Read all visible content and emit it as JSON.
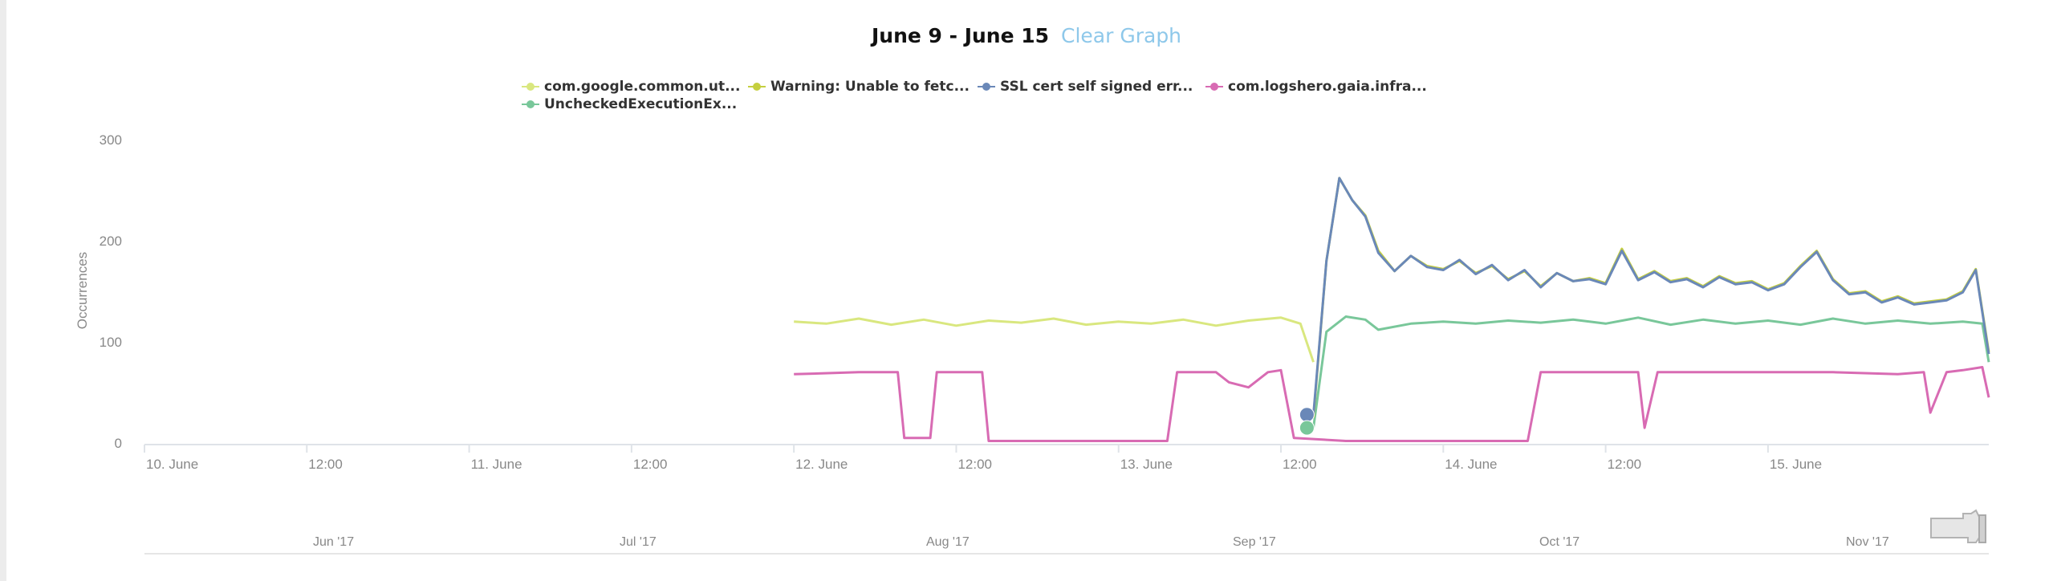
{
  "header": {
    "title": "June 9 - June 15",
    "clear_label": "Clear Graph"
  },
  "colors": {
    "series1": "#d9e77f",
    "series2": "#c5cf3f",
    "series3": "#6a88b8",
    "series4": "#d86bb3",
    "series5": "#79c79a",
    "axis": "#e3e3e3",
    "title_link": "#8ec8ea"
  },
  "chart_data": {
    "type": "line",
    "ylabel": "Occurrences",
    "ylim": [
      0,
      300
    ],
    "yticks": [
      0,
      100,
      200,
      300
    ],
    "x_ticks": [
      "10. June",
      "12:00",
      "11. June",
      "12:00",
      "12. June",
      "12:00",
      "13. June",
      "12:00",
      "14. June",
      "12:00",
      "15. June"
    ],
    "navigator_ticks": [
      "Jun '17",
      "Jul '17",
      "Aug '17",
      "Sep '17",
      "Oct '17",
      "Nov '17"
    ],
    "series": [
      {
        "name": "com.google.common.ut...",
        "color": "#d9e77f",
        "key": "s1",
        "points": [
          [
            12.0,
            120
          ],
          [
            12.1,
            118
          ],
          [
            12.2,
            123
          ],
          [
            12.3,
            117
          ],
          [
            12.4,
            122
          ],
          [
            12.5,
            116
          ],
          [
            12.6,
            121
          ],
          [
            12.7,
            119
          ],
          [
            12.8,
            123
          ],
          [
            12.9,
            117
          ],
          [
            13.0,
            120
          ],
          [
            13.1,
            118
          ],
          [
            13.2,
            122
          ],
          [
            13.3,
            116
          ],
          [
            13.4,
            121
          ],
          [
            13.5,
            124
          ],
          [
            13.56,
            118
          ],
          [
            13.6,
            80
          ]
        ]
      },
      {
        "name": "Warning: Unable to fetc...",
        "color": "#c5cf3f",
        "key": "s2",
        "points": [
          [
            13.6,
            25
          ],
          [
            13.64,
            180
          ],
          [
            13.68,
            262
          ],
          [
            13.72,
            240
          ],
          [
            13.76,
            225
          ],
          [
            13.8,
            190
          ],
          [
            13.85,
            170
          ],
          [
            13.9,
            185
          ],
          [
            13.95,
            175
          ],
          [
            14.0,
            172
          ],
          [
            14.05,
            180
          ],
          [
            14.1,
            168
          ],
          [
            14.15,
            175
          ],
          [
            14.2,
            162
          ],
          [
            14.25,
            170
          ],
          [
            14.3,
            155
          ],
          [
            14.35,
            168
          ],
          [
            14.4,
            160
          ],
          [
            14.45,
            163
          ],
          [
            14.5,
            158
          ],
          [
            14.55,
            192
          ],
          [
            14.6,
            162
          ],
          [
            14.65,
            170
          ],
          [
            14.7,
            160
          ],
          [
            14.75,
            163
          ],
          [
            14.8,
            155
          ],
          [
            14.85,
            165
          ],
          [
            14.9,
            158
          ],
          [
            14.95,
            160
          ],
          [
            15.0,
            152
          ],
          [
            15.05,
            158
          ],
          [
            15.1,
            175
          ],
          [
            15.15,
            190
          ],
          [
            15.2,
            162
          ],
          [
            15.25,
            148
          ],
          [
            15.3,
            150
          ],
          [
            15.35,
            140
          ],
          [
            15.4,
            145
          ],
          [
            15.45,
            138
          ],
          [
            15.5,
            140
          ],
          [
            15.55,
            142
          ],
          [
            15.6,
            150
          ],
          [
            15.64,
            172
          ],
          [
            15.68,
            90
          ]
        ]
      },
      {
        "name": "SSL cert self signed err...",
        "color": "#6a88b8",
        "key": "s3",
        "points": [
          [
            13.6,
            28
          ],
          [
            13.64,
            180
          ],
          [
            13.68,
            262
          ],
          [
            13.72,
            240
          ],
          [
            13.76,
            224
          ],
          [
            13.8,
            188
          ],
          [
            13.85,
            170
          ],
          [
            13.9,
            185
          ],
          [
            13.95,
            174
          ],
          [
            14.0,
            171
          ],
          [
            14.05,
            181
          ],
          [
            14.1,
            167
          ],
          [
            14.15,
            176
          ],
          [
            14.2,
            161
          ],
          [
            14.25,
            171
          ],
          [
            14.3,
            154
          ],
          [
            14.35,
            168
          ],
          [
            14.4,
            160
          ],
          [
            14.45,
            162
          ],
          [
            14.5,
            157
          ],
          [
            14.55,
            190
          ],
          [
            14.6,
            161
          ],
          [
            14.65,
            169
          ],
          [
            14.7,
            159
          ],
          [
            14.75,
            162
          ],
          [
            14.8,
            154
          ],
          [
            14.85,
            164
          ],
          [
            14.9,
            157
          ],
          [
            14.95,
            159
          ],
          [
            15.0,
            151
          ],
          [
            15.05,
            157
          ],
          [
            15.1,
            174
          ],
          [
            15.15,
            189
          ],
          [
            15.2,
            161
          ],
          [
            15.25,
            147
          ],
          [
            15.3,
            149
          ],
          [
            15.35,
            139
          ],
          [
            15.4,
            144
          ],
          [
            15.45,
            137
          ],
          [
            15.5,
            139
          ],
          [
            15.55,
            141
          ],
          [
            15.6,
            149
          ],
          [
            15.64,
            171
          ],
          [
            15.68,
            88
          ]
        ]
      },
      {
        "name": "com.logshero.gaia.infra...",
        "color": "#d86bb3",
        "key": "s4",
        "points": [
          [
            12.0,
            68
          ],
          [
            12.2,
            70
          ],
          [
            12.32,
            70
          ],
          [
            12.34,
            5
          ],
          [
            12.42,
            5
          ],
          [
            12.44,
            70
          ],
          [
            12.58,
            70
          ],
          [
            12.6,
            2
          ],
          [
            12.8,
            2
          ],
          [
            13.0,
            2
          ],
          [
            13.15,
            2
          ],
          [
            13.18,
            70
          ],
          [
            13.3,
            70
          ],
          [
            13.34,
            60
          ],
          [
            13.4,
            55
          ],
          [
            13.46,
            70
          ],
          [
            13.5,
            72
          ],
          [
            13.54,
            5
          ],
          [
            13.7,
            2
          ],
          [
            13.9,
            2
          ],
          [
            14.0,
            2
          ],
          [
            14.1,
            2
          ],
          [
            14.2,
            2
          ],
          [
            14.26,
            2
          ],
          [
            14.3,
            70
          ],
          [
            14.5,
            70
          ],
          [
            14.6,
            70
          ],
          [
            14.62,
            15
          ],
          [
            14.66,
            70
          ],
          [
            14.8,
            70
          ],
          [
            15.0,
            70
          ],
          [
            15.2,
            70
          ],
          [
            15.4,
            68
          ],
          [
            15.48,
            70
          ],
          [
            15.5,
            30
          ],
          [
            15.55,
            70
          ],
          [
            15.6,
            72
          ],
          [
            15.66,
            75
          ],
          [
            15.68,
            45
          ]
        ]
      },
      {
        "name": "UncheckedExecutionEx...",
        "color": "#79c79a",
        "key": "s5",
        "points": [
          [
            13.6,
            15
          ],
          [
            13.64,
            110
          ],
          [
            13.7,
            125
          ],
          [
            13.76,
            122
          ],
          [
            13.8,
            112
          ],
          [
            13.9,
            118
          ],
          [
            14.0,
            120
          ],
          [
            14.1,
            118
          ],
          [
            14.2,
            121
          ],
          [
            14.3,
            119
          ],
          [
            14.4,
            122
          ],
          [
            14.5,
            118
          ],
          [
            14.6,
            124
          ],
          [
            14.7,
            117
          ],
          [
            14.8,
            122
          ],
          [
            14.9,
            118
          ],
          [
            15.0,
            121
          ],
          [
            15.1,
            117
          ],
          [
            15.2,
            123
          ],
          [
            15.3,
            118
          ],
          [
            15.4,
            121
          ],
          [
            15.5,
            118
          ],
          [
            15.6,
            120
          ],
          [
            15.66,
            118
          ],
          [
            15.68,
            80
          ]
        ]
      }
    ],
    "highlight_points": [
      {
        "series": "s3",
        "x": 13.58,
        "y": 28
      },
      {
        "series": "s5",
        "x": 13.58,
        "y": 15
      }
    ]
  }
}
